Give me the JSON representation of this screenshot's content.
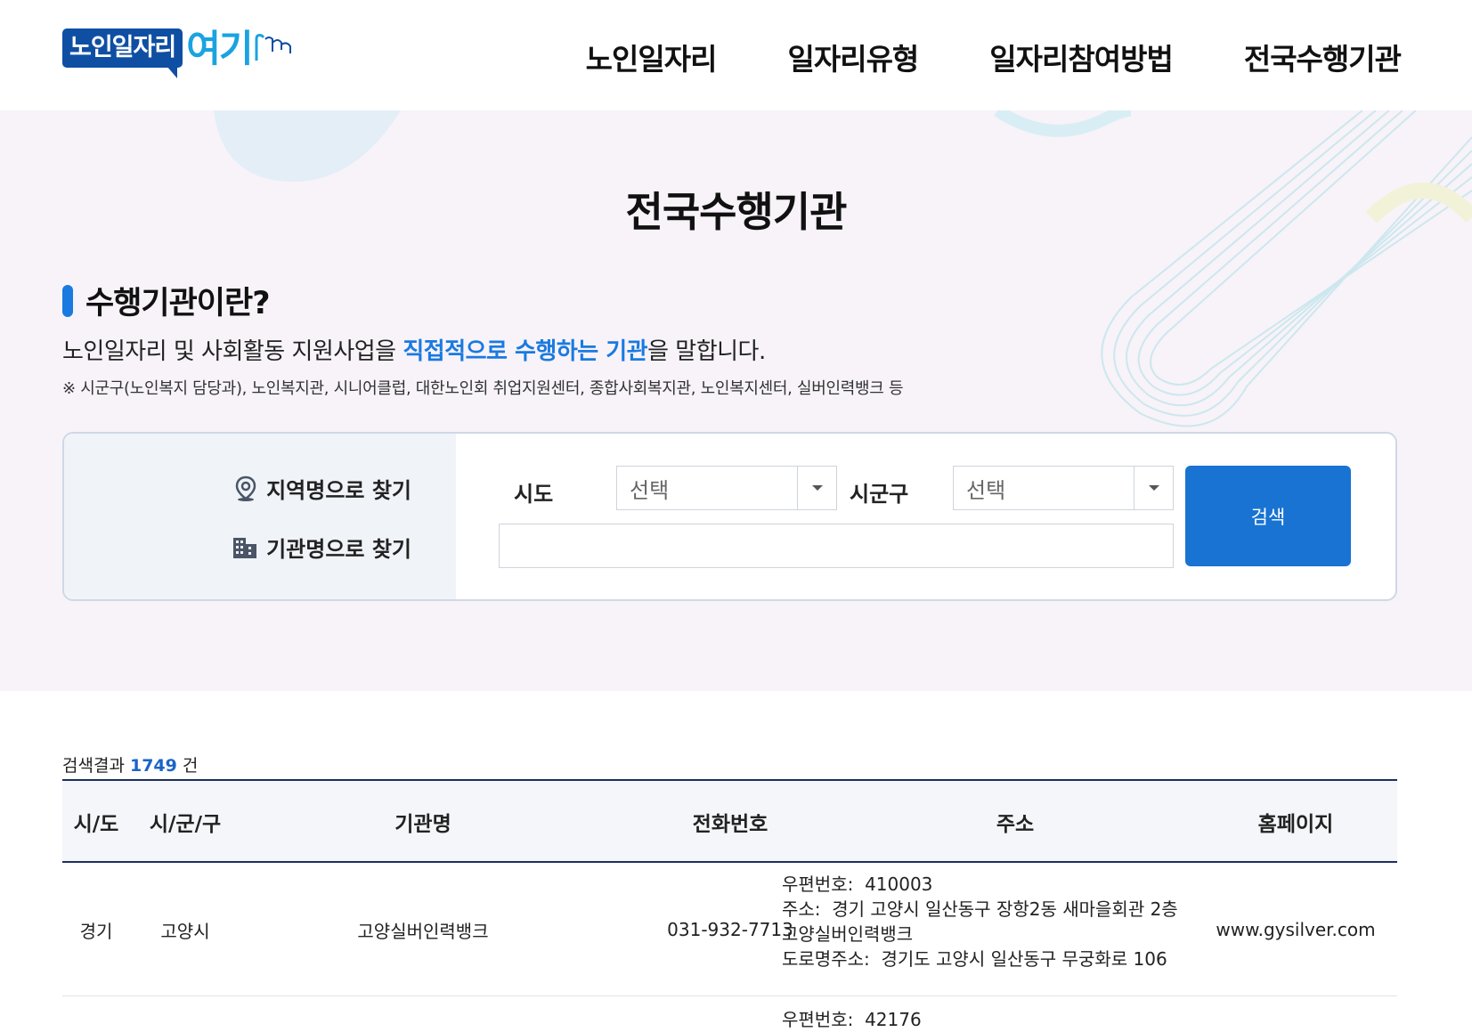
{
  "header": {
    "logo_box": "노인일자리",
    "logo_text": "여기",
    "nav": [
      "노인일자리",
      "일자리유형",
      "일자리참여방법",
      "전국수행기관"
    ]
  },
  "hero": {
    "title": "전국수행기관",
    "section_title": "수행기관이란?",
    "desc_before": "노인일자리 및 사회활동 지원사업을 ",
    "desc_highlight": "직접적으로 수행하는 기관",
    "desc_after": "을 말합니다.",
    "note": "※ 시군구(노인복지 담당과), 노인복지관, 시니어클럽, 대한노인회 취업지원센터, 종합사회복지관, 노인복지센터, 실버인력뱅크 등"
  },
  "search": {
    "find_by_region": "지역명으로 찾기",
    "find_by_org": "기관명으로 찾기",
    "sido_label": "시도",
    "sido_value": "선택",
    "sigungu_label": "시군구",
    "sigungu_value": "선택",
    "org_name_value": "",
    "button": "검색"
  },
  "results": {
    "count_prefix": "검색결과 ",
    "count": "1749",
    "count_suffix": " 건",
    "columns": [
      "시/도",
      "시/군/구",
      "기관명",
      "전화번호",
      "주소",
      "홈페이지"
    ],
    "rows": [
      {
        "sido": "경기",
        "sigungu": "고양시",
        "org": "고양실버인력뱅크",
        "phone": "031-932-7713",
        "postal_label": "우편번호:",
        "postal": "410003",
        "addr_label": "주소:",
        "addr": "경기 고양시 일산동구 장항2동 새마을회관 2층 고양실버인력뱅크",
        "road_label": "도로명주소:",
        "road": "경기도 고양시 일산동구 무궁화로 106",
        "homepage": "www.gysilver.com"
      }
    ],
    "next_row_postal_label": "우편번호:",
    "next_row_postal": "42176"
  },
  "colors": {
    "brand_blue": "#0f4fa3",
    "accent_blue": "#1a7ae0",
    "button_blue": "#1873d3",
    "hero_bg": "#f7f3f9",
    "table_border": "#1c2f5e"
  }
}
